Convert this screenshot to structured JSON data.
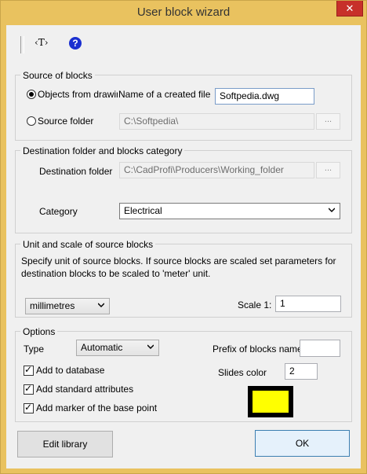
{
  "window": {
    "title": "User block wizard",
    "close_glyph": "✕"
  },
  "toolbar": {
    "t_tool": "‹T›",
    "help_glyph": "?"
  },
  "source": {
    "legend": "Source of blocks",
    "opt_drawing": "Objects from drawing",
    "file_label": "Name of a created file",
    "file_value": "Softpedia.dwg",
    "opt_folder": "Source folder",
    "folder_value": "C:\\Softpedia\\",
    "browse": "...",
    "selected": "drawing"
  },
  "destination": {
    "legend": "Destination folder and blocks category",
    "folder_label": "Destination folder",
    "folder_value": "C:\\CadProfi\\Producers\\Working_folder",
    "browse": "...",
    "category_label": "Category",
    "category_value": "Electrical"
  },
  "unit": {
    "legend": "Unit and scale of source blocks",
    "description": "Specify unit of source blocks. If source blocks are scaled set parameters for destination blocks to be scaled to 'meter' unit.",
    "unit_value": "millimetres",
    "scale_label": "Scale  1:",
    "scale_value": "1"
  },
  "options": {
    "legend": "Options",
    "type_label": "Type",
    "type_value": "Automatic",
    "prefix_label": "Prefix of blocks names",
    "prefix_value": "",
    "slides_label": "Slides color",
    "slides_value": "2",
    "swatch_color": "#ffff00",
    "add_database": "Add to database",
    "add_attributes": "Add standard attributes",
    "add_marker": "Add marker of the base point"
  },
  "buttons": {
    "edit_library": "Edit library",
    "ok": "OK"
  }
}
